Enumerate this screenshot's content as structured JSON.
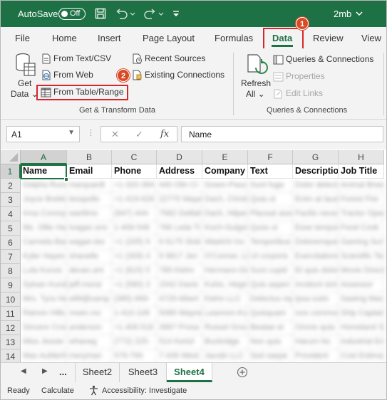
{
  "titlebar": {
    "autosave_label": "AutoSave",
    "autosave_state": "Off",
    "filename": "2mb",
    "icons": [
      "save-icon",
      "undo-icon",
      "redo-icon",
      "customize-qat-icon",
      "chevron-down-icon"
    ]
  },
  "tabs": [
    "File",
    "Home",
    "Insert",
    "Page Layout",
    "Formulas",
    "Data",
    "Review",
    "View"
  ],
  "active_tab": "Data",
  "callouts": [
    "1",
    "2"
  ],
  "ribbon": {
    "get_data": {
      "line1": "Get",
      "line2": "Data"
    },
    "from_text_csv": "From Text/CSV",
    "from_web": "From Web",
    "from_table_range": "From Table/Range",
    "recent_sources": "Recent Sources",
    "existing_connections": "Existing Connections",
    "group1_label": "Get & Transform Data",
    "refresh": {
      "line1": "Refresh",
      "line2": "All"
    },
    "queries_connections": "Queries & Connections",
    "properties": "Properties",
    "edit_links": "Edit Links",
    "group2_label": "Queries & Connections"
  },
  "formula_bar": {
    "name_box": "A1",
    "fx_symbol": "fx",
    "cancel_symbol": "✕",
    "enter_symbol": "✓",
    "content": "Name"
  },
  "grid": {
    "columns": [
      "A",
      "B",
      "C",
      "D",
      "E",
      "F",
      "G",
      "H"
    ],
    "rows": [
      "1",
      "2",
      "3",
      "4",
      "5",
      "6",
      "7",
      "8",
      "9",
      "10",
      "11",
      "12",
      "13",
      "14"
    ],
    "header_row": [
      "Name",
      "Email",
      "Phone",
      "Address",
      "Company",
      "Text",
      "Description",
      "Job Title"
    ],
    "data_rows": [
      [
        "Delpha Runolfsdottir",
        "marquardt",
        "+1-320-394",
        "440 Olin Cl",
        "Green-Paucek",
        "Sunt fuga",
        "Dolor delectus",
        "Animal Breeder"
      ],
      [
        "Joyce Brekke",
        "lesspollo",
        "+1-419-626",
        "22770 Mayer",
        "Dach, Christiansen",
        "Quia ut",
        "Enim at laudantium",
        "Forest Fire"
      ],
      [
        "Irma Conroy",
        "warilimo",
        "(947) 444-",
        "7582 Delilah",
        "Dach, Hilpert",
        "Placeat assum",
        "Facilis necessit",
        "Tractor Operator"
      ],
      [
        "Ms. Ollie Hane",
        "tvagan.sno",
        "1-406-546",
        "766 Leda Tr",
        "Koch-Gulgowski",
        "Quos ut",
        "Esse tempora",
        "Food Cook"
      ],
      [
        "Carmela Baumbach",
        "wagan.leo",
        "+1 (205) 9",
        "9 6175 Stok",
        "Waelchi Inc",
        "Temporibus",
        "Doloremque eos",
        "Gaming Surveillance"
      ],
      [
        "Kyler Hayes",
        "shanelle",
        "+1 (309) 4",
        "9 9817 Jen",
        "O'Conner, Lind",
        "Ut corporis",
        "Exercitationem",
        "Scientific Tech"
      ],
      [
        "Lula Kunze",
        "devan.ant",
        "+1 (815) 5",
        "789 Klehn",
        "Hermann-Deckow",
        "Sunt cupid",
        "Et quis dolor",
        "Movie Director"
      ],
      [
        "Sylvan Kunde",
        "jeff.morar",
        "+1 (580) 3",
        "1542 Davis",
        "Kuhic, Hegmann",
        "Quis asperi",
        "Incidunt sint",
        "Assessor"
      ],
      [
        "Mrs. Tyra Hessel",
        "e89@xamp",
        "(385) 669-",
        "4729 Albert",
        "Kiehn LLC",
        "Delectus rep",
        "Ipsa iusto",
        "Sawing Machine"
      ],
      [
        "Ramon Hills",
        "moen.mc",
        "1-410-106",
        "5089 Wayne",
        "Leannon-Kub",
        "Quisquam",
        "Iure commodi",
        "Ship Captain"
      ],
      [
        "Sincere Crona",
        "anderson",
        "+1.409.516",
        "3967 Prosa",
        "Russel Group",
        "Beatae et",
        "Omnis quia",
        "Homeland Security"
      ],
      [
        "Miss Jessie Kling",
        "whaneg",
        "(772) 225-",
        "514 Kertzl",
        "Buckridge",
        "Non quis",
        "Harum hic",
        "Industrial Engineer"
      ],
      [
        "Max Aufderhar",
        "meryman",
        "579-794",
        "7-439 West",
        "Jacobi LLC",
        "Sed saepe",
        "Provident",
        "Cost Estimator"
      ]
    ]
  },
  "sheet_tabs": [
    "Sheet2",
    "Sheet3",
    "Sheet4"
  ],
  "active_sheet": "Sheet4",
  "sheet_nav": {
    "ellipsis": "..."
  },
  "status": {
    "ready": "Ready",
    "calculate": "Calculate",
    "accessibility": "Accessibility: Investigate"
  },
  "colors": {
    "excel_green": "#1e7145",
    "callout_red": "#d9242b",
    "badge_orange": "#d84a26"
  }
}
